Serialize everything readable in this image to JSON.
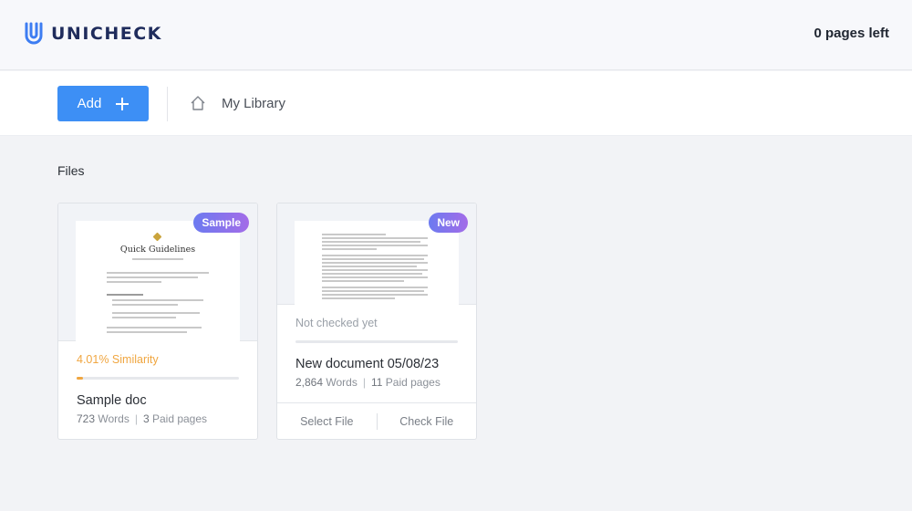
{
  "header": {
    "brand": "UNICHECK",
    "pages_left": "0 pages left",
    "brand_color": "#1f2c5c"
  },
  "toolbar": {
    "add_label": "Add",
    "breadcrumb": "My Library",
    "accent": "#3d8ff5"
  },
  "files": {
    "title": "Files",
    "cards": [
      {
        "badge": "Sample",
        "preview_title": "Quick Guidelines",
        "status": "4.01% Similarity",
        "similarity_percent": 4.01,
        "name": "Sample doc",
        "words": "723",
        "words_label": "Words",
        "pages": "3",
        "pages_label": "Paid pages"
      },
      {
        "badge": "New",
        "status": "Not checked yet",
        "name": "New document 05/08/23",
        "words": "2,864",
        "words_label": "Words",
        "pages": "11",
        "pages_label": "Paid pages",
        "actions": [
          "Select File",
          "Check File"
        ]
      }
    ]
  },
  "icons": {
    "logo": "unicheck-logo-icon",
    "home": "home-icon",
    "add": "plus-icon"
  }
}
